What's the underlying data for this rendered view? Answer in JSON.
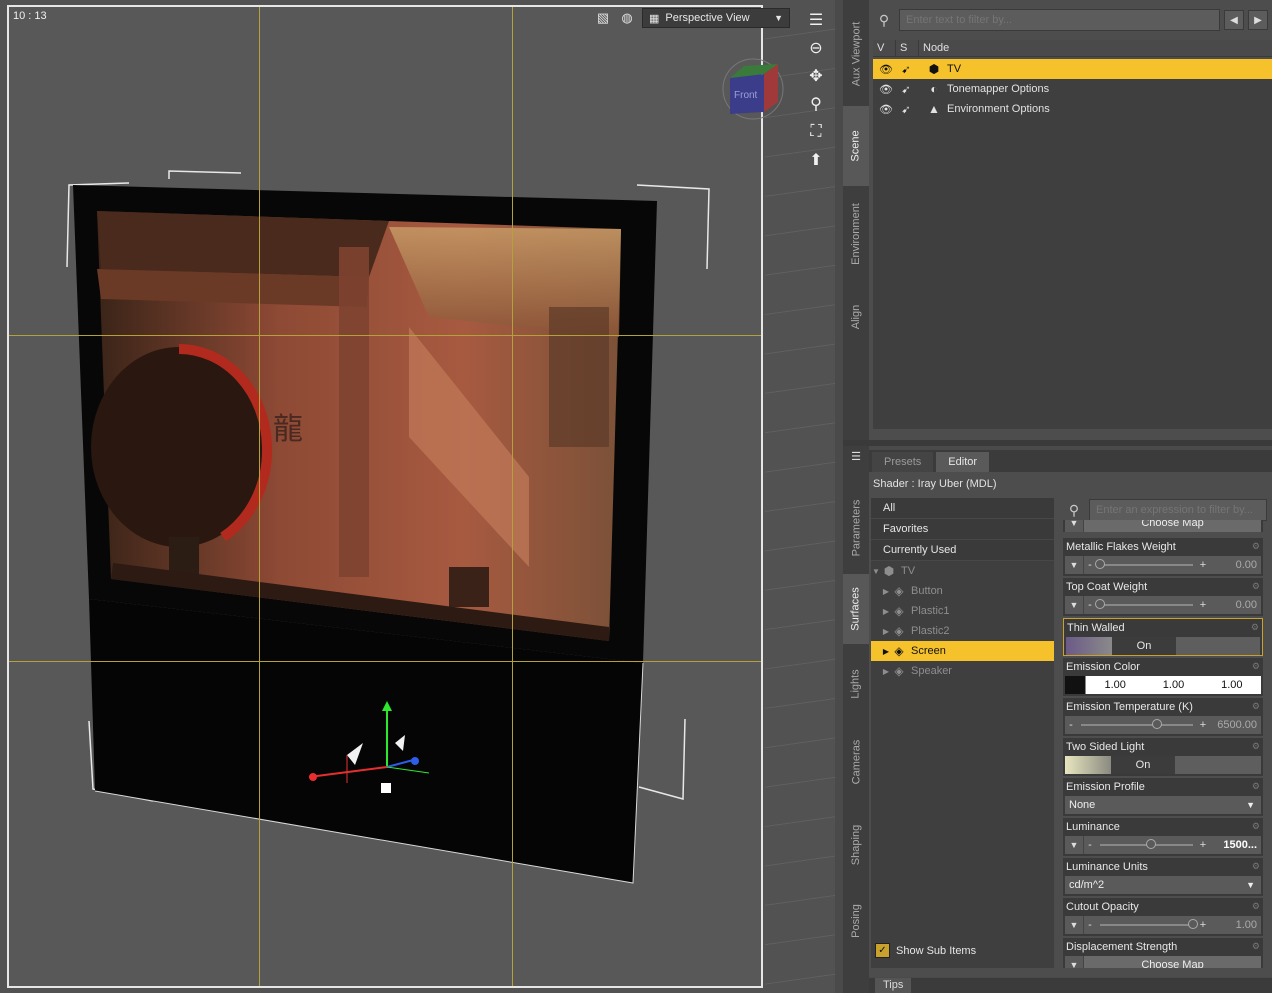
{
  "viewport": {
    "time": "10 : 13",
    "view_label": "Perspective View",
    "cube_face": "Front"
  },
  "side_tabs_top": [
    "Aux Viewport",
    "Scene",
    "Environment",
    "Align"
  ],
  "side_tabs_bottom": [
    "Parameters",
    "Surfaces",
    "Lights",
    "Cameras",
    "Shaping",
    "Posing"
  ],
  "scene": {
    "filter_placeholder": "Enter text to filter by...",
    "columns": {
      "v": "V",
      "s": "S",
      "node": "Node"
    },
    "rows": [
      {
        "label": "TV",
        "selected": true
      },
      {
        "label": "Tonemapper Options",
        "selected": false
      },
      {
        "label": "Environment Options",
        "selected": false
      }
    ]
  },
  "surfaces": {
    "tabs": [
      "Presets",
      "Editor"
    ],
    "shader_label": "Shader :",
    "shader_name": "Iray Uber (MDL)",
    "categories": [
      "All",
      "Favorites",
      "Currently Used"
    ],
    "tree_root": "TV",
    "tree_items": [
      "Button",
      "Plastic1",
      "Plastic2",
      "Screen",
      "Speaker"
    ],
    "selected_item": "Screen",
    "show_sub_items": "Show Sub Items",
    "filter_placeholder": "Enter an expression to filter by...",
    "props": {
      "choose_map_top": "Choose Map",
      "metallic_flakes": {
        "label": "Metallic Flakes Weight",
        "value": "0.00",
        "fraction": 0.0
      },
      "top_coat": {
        "label": "Top Coat Weight",
        "value": "0.00",
        "fraction": 0.0
      },
      "thin_walled": {
        "label": "Thin Walled",
        "value": "On"
      },
      "emission_color": {
        "label": "Emission Color",
        "r": "1.00",
        "g": "1.00",
        "b": "1.00"
      },
      "emission_temp": {
        "label": "Emission Temperature (K)",
        "value": "6500.00",
        "fraction": 0.68
      },
      "two_sided": {
        "label": "Two Sided Light",
        "value": "On"
      },
      "emission_profile": {
        "label": "Emission Profile",
        "value": "None"
      },
      "luminance": {
        "label": "Luminance",
        "value": "1500...",
        "fraction": 0.55
      },
      "luminance_units": {
        "label": "Luminance Units",
        "value": "cd/m^2"
      },
      "cutout_opacity": {
        "label": "Cutout Opacity",
        "value": "1.00",
        "fraction": 1.0
      },
      "displacement": {
        "label": "Displacement Strength",
        "map": "Choose Map"
      }
    }
  },
  "tips_label": "Tips",
  "colors": {
    "selection": "#f6c22b",
    "guide": "#b5a13a",
    "panel": "#4d4d4d"
  }
}
